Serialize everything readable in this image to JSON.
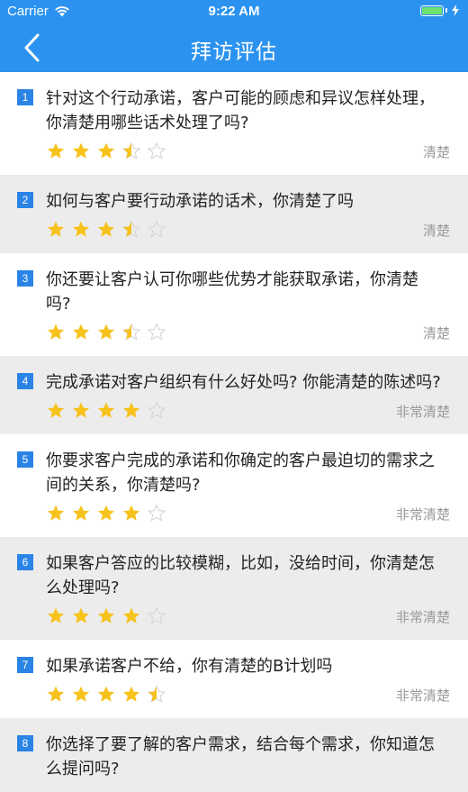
{
  "colors": {
    "accent": "#2b93ef",
    "star": "#f7c21b",
    "number_badge": "#2a84e6"
  },
  "status_bar": {
    "carrier": "Carrier",
    "time": "9:22 AM"
  },
  "nav": {
    "title": "拜访评估",
    "back_icon": "chevron-left-icon"
  },
  "items": [
    {
      "num": "1",
      "question": "针对这个行动承诺，客户可能的顾虑和异议怎样处理，你清楚用哪些话术处理了吗?",
      "rating": 3.5,
      "grade": "清楚"
    },
    {
      "num": "2",
      "question": "如何与客户要行动承诺的话术，你清楚了吗",
      "rating": 3.5,
      "grade": "清楚"
    },
    {
      "num": "3",
      "question": "你还要让客户认可你哪些优势才能获取承诺，你清楚吗?",
      "rating": 3.5,
      "grade": "清楚"
    },
    {
      "num": "4",
      "question": "完成承诺对客户组织有什么好处吗? 你能清楚的陈述吗?",
      "rating": 4,
      "grade": "非常清楚"
    },
    {
      "num": "5",
      "question": "你要求客户完成的承诺和你确定的客户最迫切的需求之间的关系，你清楚吗?",
      "rating": 4,
      "grade": "非常清楚"
    },
    {
      "num": "6",
      "question": "如果客户答应的比较模糊，比如，没给时间，你清楚怎么处理吗?",
      "rating": 4,
      "grade": "非常清楚"
    },
    {
      "num": "7",
      "question": "如果承诺客户不给，你有清楚的B计划吗",
      "rating": 4.5,
      "grade": "非常清楚"
    },
    {
      "num": "8",
      "question": "你选择了要了解的客户需求，结合每个需求，你知道怎么提问吗?",
      "rating": null,
      "grade": ""
    }
  ]
}
